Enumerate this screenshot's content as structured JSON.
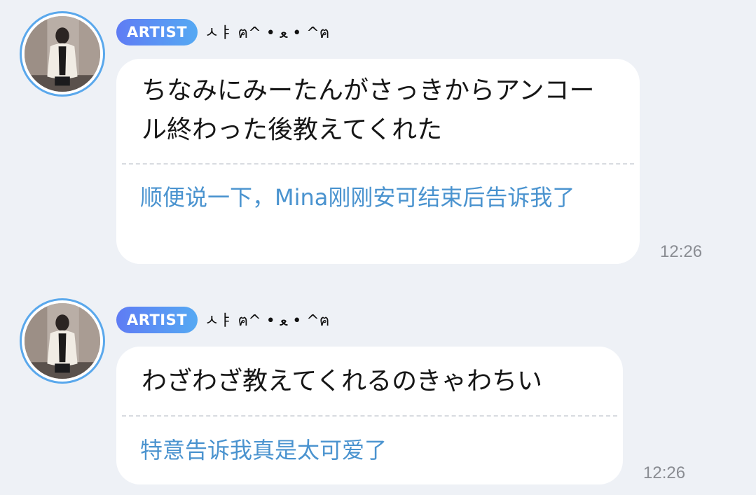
{
  "messages": [
    {
      "badge": "ARTIST",
      "nickname": "ㅅㅑ ฅ^ • ﻌ • ^ฅ",
      "original": "ちなみにみーたんがさっきからアンコール終わった後教えてくれた",
      "translation": "顺便说一下，Mina刚刚安可结束后告诉我了",
      "time": "12:26"
    },
    {
      "badge": "ARTIST",
      "nickname": "ㅅㅑ ฅ^ • ﻌ • ^ฅ",
      "original": "わざわざ教えてくれるのきゃわちい",
      "translation": "特意告诉我真是太可爱了",
      "time": "12:26"
    }
  ],
  "colors": {
    "background": "#eef1f6",
    "badge_gradient_start": "#5f7cf4",
    "badge_gradient_end": "#55a9f3",
    "translation_text": "#4a93cf",
    "avatar_ring": "#5aa8ec"
  }
}
